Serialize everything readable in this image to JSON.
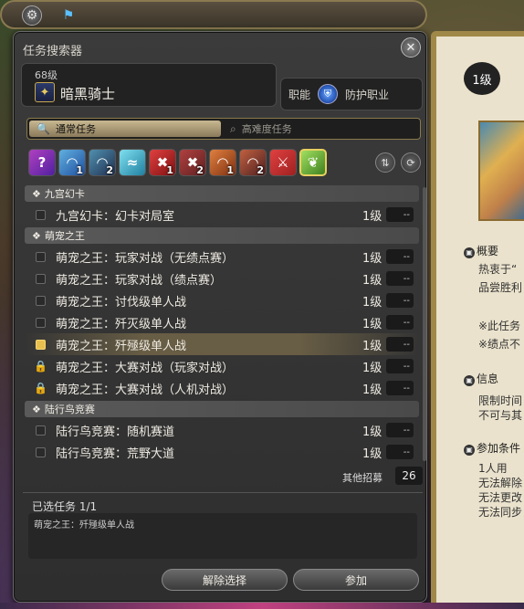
{
  "window": {
    "title": "任务搜索器"
  },
  "job": {
    "level": "68级",
    "name": "暗黑骑士",
    "role_label": "职能",
    "role_value": "防护职业"
  },
  "tabs": [
    {
      "label": "通常任务",
      "icon": "search-icon"
    },
    {
      "label": "高难度任务",
      "icon": "search-icon"
    }
  ],
  "filters": [
    {
      "icon": "question-icon",
      "count": ""
    },
    {
      "icon": "dungeon-icon",
      "count": "1"
    },
    {
      "icon": "guildhest-icon",
      "count": "2"
    },
    {
      "icon": "trial-icon",
      "count": ""
    },
    {
      "icon": "raid-icon",
      "count": "1"
    },
    {
      "icon": "pvp-icon",
      "count": "2"
    },
    {
      "icon": "gold-saucer-icon",
      "count": "1"
    },
    {
      "icon": "ex-icon",
      "count": "2"
    },
    {
      "icon": "crossed-swords-icon",
      "count": ""
    },
    {
      "icon": "chocobo-icon",
      "count": ""
    }
  ],
  "categories": {
    "c1": "九宫幻卡",
    "c2": "萌宠之王",
    "c3": "陆行鸟竞赛"
  },
  "rows": [
    {
      "name": "九宫幻卡：幻卡对局室",
      "level": "1级",
      "dash": "--"
    },
    {
      "name": "萌宠之王：玩家对战（无绩点赛）",
      "level": "1级",
      "dash": "--"
    },
    {
      "name": "萌宠之王：玩家对战（绩点赛）",
      "level": "1级",
      "dash": "--"
    },
    {
      "name": "萌宠之王：讨伐级单人战",
      "level": "1级",
      "dash": "--"
    },
    {
      "name": "萌宠之王：歼灭级单人战",
      "level": "1级",
      "dash": "--"
    },
    {
      "name": "萌宠之王：歼殛级单人战",
      "level": "1级",
      "dash": "--"
    },
    {
      "name": "萌宠之王：大赛对战（玩家对战）",
      "level": "1级",
      "dash": "--"
    },
    {
      "name": "萌宠之王：大赛对战（人机对战）",
      "level": "1级",
      "dash": "--"
    },
    {
      "name": "陆行鸟竞赛：随机赛道",
      "level": "1级",
      "dash": "--"
    },
    {
      "name": "陆行鸟竞赛：荒野大道",
      "level": "1级",
      "dash": "--"
    }
  ],
  "recruit": {
    "label": "其他招募",
    "count": "26"
  },
  "selected": {
    "title": "已选任务 1/1",
    "item": "萌宠之王：歼殛级单人战"
  },
  "buttons": {
    "clear": "解除选择",
    "join": "参加"
  },
  "right_panel": {
    "level": "1级",
    "section1": "概要",
    "line1": "热衷于“",
    "line2": "品尝胜利",
    "note1": "※此任务",
    "note2": "※绩点不",
    "section2": "信息",
    "info1": "限制时间",
    "info2": "不可与其",
    "section3": "参加条件",
    "cond1": "1人用",
    "cond2": "无法解除",
    "cond3": "无法更改",
    "cond4": "无法同步"
  }
}
